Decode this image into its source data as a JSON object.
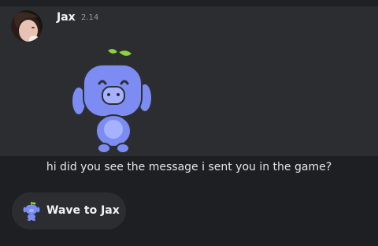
{
  "message": {
    "author": "Jax",
    "timestamp": "2.14",
    "avatar_icon": "user-avatar-icon",
    "sticker_icon": "wumpus-wave-sticker-icon",
    "caption": "hi did you see the message i sent you in the game?"
  },
  "wave_button": {
    "label": "Wave to Jax",
    "icon": "wumpus-small-icon"
  },
  "colors": {
    "background": "#2b2d31",
    "bottom_background": "#1e1f22",
    "text": "#f2f3f5",
    "muted": "#949ba4",
    "wumpus": "#7c8cf2"
  }
}
